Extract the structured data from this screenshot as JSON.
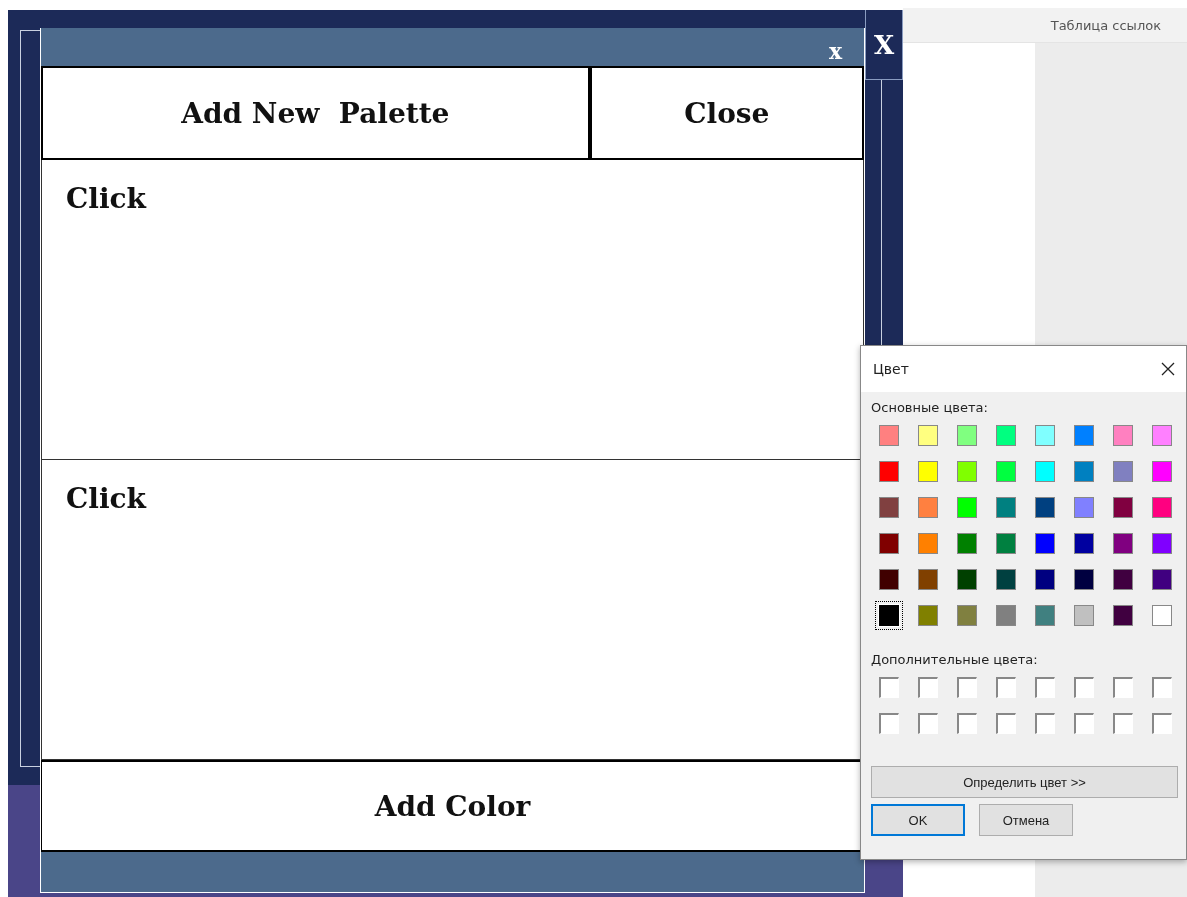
{
  "back_window": {
    "close": "X"
  },
  "side_panel": {
    "title": "Таблица ссылок"
  },
  "palette_window": {
    "close": "x",
    "buttons": [
      {
        "label": "Add New  Palette"
      },
      {
        "label": "Close"
      }
    ],
    "slots": [
      {
        "label": "Click"
      },
      {
        "label": "Click"
      }
    ],
    "add_button": "Add Color"
  },
  "color_dialog": {
    "title": "Цвет",
    "basic_label": "Основные цвета:",
    "basic_colors": [
      {
        "color": "#ff8080",
        "selected": false
      },
      {
        "color": "#ffff80",
        "selected": false
      },
      {
        "color": "#80ff80",
        "selected": false
      },
      {
        "color": "#00ff80",
        "selected": false
      },
      {
        "color": "#80ffff",
        "selected": false
      },
      {
        "color": "#0080ff",
        "selected": false
      },
      {
        "color": "#ff80c0",
        "selected": false
      },
      {
        "color": "#ff80ff",
        "selected": false
      },
      {
        "color": "#ff0000",
        "selected": false
      },
      {
        "color": "#ffff00",
        "selected": false
      },
      {
        "color": "#80ff00",
        "selected": false
      },
      {
        "color": "#00ff40",
        "selected": false
      },
      {
        "color": "#00ffff",
        "selected": false
      },
      {
        "color": "#0080c0",
        "selected": false
      },
      {
        "color": "#8080c0",
        "selected": false
      },
      {
        "color": "#ff00ff",
        "selected": false
      },
      {
        "color": "#804040",
        "selected": false
      },
      {
        "color": "#ff8040",
        "selected": false
      },
      {
        "color": "#00ff00",
        "selected": false
      },
      {
        "color": "#008080",
        "selected": false
      },
      {
        "color": "#004080",
        "selected": false
      },
      {
        "color": "#8080ff",
        "selected": false
      },
      {
        "color": "#800040",
        "selected": false
      },
      {
        "color": "#ff0080",
        "selected": false
      },
      {
        "color": "#800000",
        "selected": false
      },
      {
        "color": "#ff8000",
        "selected": false
      },
      {
        "color": "#008000",
        "selected": false
      },
      {
        "color": "#008040",
        "selected": false
      },
      {
        "color": "#0000ff",
        "selected": false
      },
      {
        "color": "#0000a0",
        "selected": false
      },
      {
        "color": "#800080",
        "selected": false
      },
      {
        "color": "#8000ff",
        "selected": false
      },
      {
        "color": "#400000",
        "selected": false
      },
      {
        "color": "#804000",
        "selected": false
      },
      {
        "color": "#004000",
        "selected": false
      },
      {
        "color": "#004040",
        "selected": false
      },
      {
        "color": "#000080",
        "selected": false
      },
      {
        "color": "#000040",
        "selected": false
      },
      {
        "color": "#400040",
        "selected": false
      },
      {
        "color": "#400080",
        "selected": false
      },
      {
        "color": "#000000",
        "selected": true
      },
      {
        "color": "#808000",
        "selected": false
      },
      {
        "color": "#808040",
        "selected": false
      },
      {
        "color": "#808080",
        "selected": false
      },
      {
        "color": "#408080",
        "selected": false
      },
      {
        "color": "#c0c0c0",
        "selected": false
      },
      {
        "color": "#400040",
        "selected": false
      },
      {
        "color": "#ffffff",
        "selected": false
      }
    ],
    "custom_label": "Дополнительные цвета:",
    "custom_colors": [
      {
        "selected": false
      },
      {
        "selected": false
      },
      {
        "selected": false
      },
      {
        "selected": false
      },
      {
        "selected": false
      },
      {
        "selected": false
      },
      {
        "selected": false
      },
      {
        "selected": false
      },
      {
        "selected": false
      },
      {
        "selected": false
      },
      {
        "selected": false
      },
      {
        "selected": false
      },
      {
        "selected": false
      },
      {
        "selected": false
      },
      {
        "selected": false
      },
      {
        "selected": false
      }
    ],
    "define_button": "Определить цвет >>",
    "ok_button": "OK",
    "cancel_button": "Отмена"
  }
}
